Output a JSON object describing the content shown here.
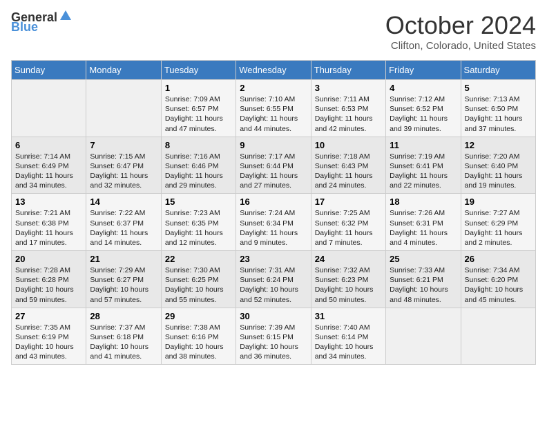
{
  "header": {
    "logo_general": "General",
    "logo_blue": "Blue",
    "month": "October 2024",
    "location": "Clifton, Colorado, United States"
  },
  "weekdays": [
    "Sunday",
    "Monday",
    "Tuesday",
    "Wednesday",
    "Thursday",
    "Friday",
    "Saturday"
  ],
  "weeks": [
    [
      {
        "day": "",
        "sunrise": "",
        "sunset": "",
        "daylight": ""
      },
      {
        "day": "",
        "sunrise": "",
        "sunset": "",
        "daylight": ""
      },
      {
        "day": "1",
        "sunrise": "Sunrise: 7:09 AM",
        "sunset": "Sunset: 6:57 PM",
        "daylight": "Daylight: 11 hours and 47 minutes."
      },
      {
        "day": "2",
        "sunrise": "Sunrise: 7:10 AM",
        "sunset": "Sunset: 6:55 PM",
        "daylight": "Daylight: 11 hours and 44 minutes."
      },
      {
        "day": "3",
        "sunrise": "Sunrise: 7:11 AM",
        "sunset": "Sunset: 6:53 PM",
        "daylight": "Daylight: 11 hours and 42 minutes."
      },
      {
        "day": "4",
        "sunrise": "Sunrise: 7:12 AM",
        "sunset": "Sunset: 6:52 PM",
        "daylight": "Daylight: 11 hours and 39 minutes."
      },
      {
        "day": "5",
        "sunrise": "Sunrise: 7:13 AM",
        "sunset": "Sunset: 6:50 PM",
        "daylight": "Daylight: 11 hours and 37 minutes."
      }
    ],
    [
      {
        "day": "6",
        "sunrise": "Sunrise: 7:14 AM",
        "sunset": "Sunset: 6:49 PM",
        "daylight": "Daylight: 11 hours and 34 minutes."
      },
      {
        "day": "7",
        "sunrise": "Sunrise: 7:15 AM",
        "sunset": "Sunset: 6:47 PM",
        "daylight": "Daylight: 11 hours and 32 minutes."
      },
      {
        "day": "8",
        "sunrise": "Sunrise: 7:16 AM",
        "sunset": "Sunset: 6:46 PM",
        "daylight": "Daylight: 11 hours and 29 minutes."
      },
      {
        "day": "9",
        "sunrise": "Sunrise: 7:17 AM",
        "sunset": "Sunset: 6:44 PM",
        "daylight": "Daylight: 11 hours and 27 minutes."
      },
      {
        "day": "10",
        "sunrise": "Sunrise: 7:18 AM",
        "sunset": "Sunset: 6:43 PM",
        "daylight": "Daylight: 11 hours and 24 minutes."
      },
      {
        "day": "11",
        "sunrise": "Sunrise: 7:19 AM",
        "sunset": "Sunset: 6:41 PM",
        "daylight": "Daylight: 11 hours and 22 minutes."
      },
      {
        "day": "12",
        "sunrise": "Sunrise: 7:20 AM",
        "sunset": "Sunset: 6:40 PM",
        "daylight": "Daylight: 11 hours and 19 minutes."
      }
    ],
    [
      {
        "day": "13",
        "sunrise": "Sunrise: 7:21 AM",
        "sunset": "Sunset: 6:38 PM",
        "daylight": "Daylight: 11 hours and 17 minutes."
      },
      {
        "day": "14",
        "sunrise": "Sunrise: 7:22 AM",
        "sunset": "Sunset: 6:37 PM",
        "daylight": "Daylight: 11 hours and 14 minutes."
      },
      {
        "day": "15",
        "sunrise": "Sunrise: 7:23 AM",
        "sunset": "Sunset: 6:35 PM",
        "daylight": "Daylight: 11 hours and 12 minutes."
      },
      {
        "day": "16",
        "sunrise": "Sunrise: 7:24 AM",
        "sunset": "Sunset: 6:34 PM",
        "daylight": "Daylight: 11 hours and 9 minutes."
      },
      {
        "day": "17",
        "sunrise": "Sunrise: 7:25 AM",
        "sunset": "Sunset: 6:32 PM",
        "daylight": "Daylight: 11 hours and 7 minutes."
      },
      {
        "day": "18",
        "sunrise": "Sunrise: 7:26 AM",
        "sunset": "Sunset: 6:31 PM",
        "daylight": "Daylight: 11 hours and 4 minutes."
      },
      {
        "day": "19",
        "sunrise": "Sunrise: 7:27 AM",
        "sunset": "Sunset: 6:29 PM",
        "daylight": "Daylight: 11 hours and 2 minutes."
      }
    ],
    [
      {
        "day": "20",
        "sunrise": "Sunrise: 7:28 AM",
        "sunset": "Sunset: 6:28 PM",
        "daylight": "Daylight: 10 hours and 59 minutes."
      },
      {
        "day": "21",
        "sunrise": "Sunrise: 7:29 AM",
        "sunset": "Sunset: 6:27 PM",
        "daylight": "Daylight: 10 hours and 57 minutes."
      },
      {
        "day": "22",
        "sunrise": "Sunrise: 7:30 AM",
        "sunset": "Sunset: 6:25 PM",
        "daylight": "Daylight: 10 hours and 55 minutes."
      },
      {
        "day": "23",
        "sunrise": "Sunrise: 7:31 AM",
        "sunset": "Sunset: 6:24 PM",
        "daylight": "Daylight: 10 hours and 52 minutes."
      },
      {
        "day": "24",
        "sunrise": "Sunrise: 7:32 AM",
        "sunset": "Sunset: 6:23 PM",
        "daylight": "Daylight: 10 hours and 50 minutes."
      },
      {
        "day": "25",
        "sunrise": "Sunrise: 7:33 AM",
        "sunset": "Sunset: 6:21 PM",
        "daylight": "Daylight: 10 hours and 48 minutes."
      },
      {
        "day": "26",
        "sunrise": "Sunrise: 7:34 AM",
        "sunset": "Sunset: 6:20 PM",
        "daylight": "Daylight: 10 hours and 45 minutes."
      }
    ],
    [
      {
        "day": "27",
        "sunrise": "Sunrise: 7:35 AM",
        "sunset": "Sunset: 6:19 PM",
        "daylight": "Daylight: 10 hours and 43 minutes."
      },
      {
        "day": "28",
        "sunrise": "Sunrise: 7:37 AM",
        "sunset": "Sunset: 6:18 PM",
        "daylight": "Daylight: 10 hours and 41 minutes."
      },
      {
        "day": "29",
        "sunrise": "Sunrise: 7:38 AM",
        "sunset": "Sunset: 6:16 PM",
        "daylight": "Daylight: 10 hours and 38 minutes."
      },
      {
        "day": "30",
        "sunrise": "Sunrise: 7:39 AM",
        "sunset": "Sunset: 6:15 PM",
        "daylight": "Daylight: 10 hours and 36 minutes."
      },
      {
        "day": "31",
        "sunrise": "Sunrise: 7:40 AM",
        "sunset": "Sunset: 6:14 PM",
        "daylight": "Daylight: 10 hours and 34 minutes."
      },
      {
        "day": "",
        "sunrise": "",
        "sunset": "",
        "daylight": ""
      },
      {
        "day": "",
        "sunrise": "",
        "sunset": "",
        "daylight": ""
      }
    ]
  ]
}
